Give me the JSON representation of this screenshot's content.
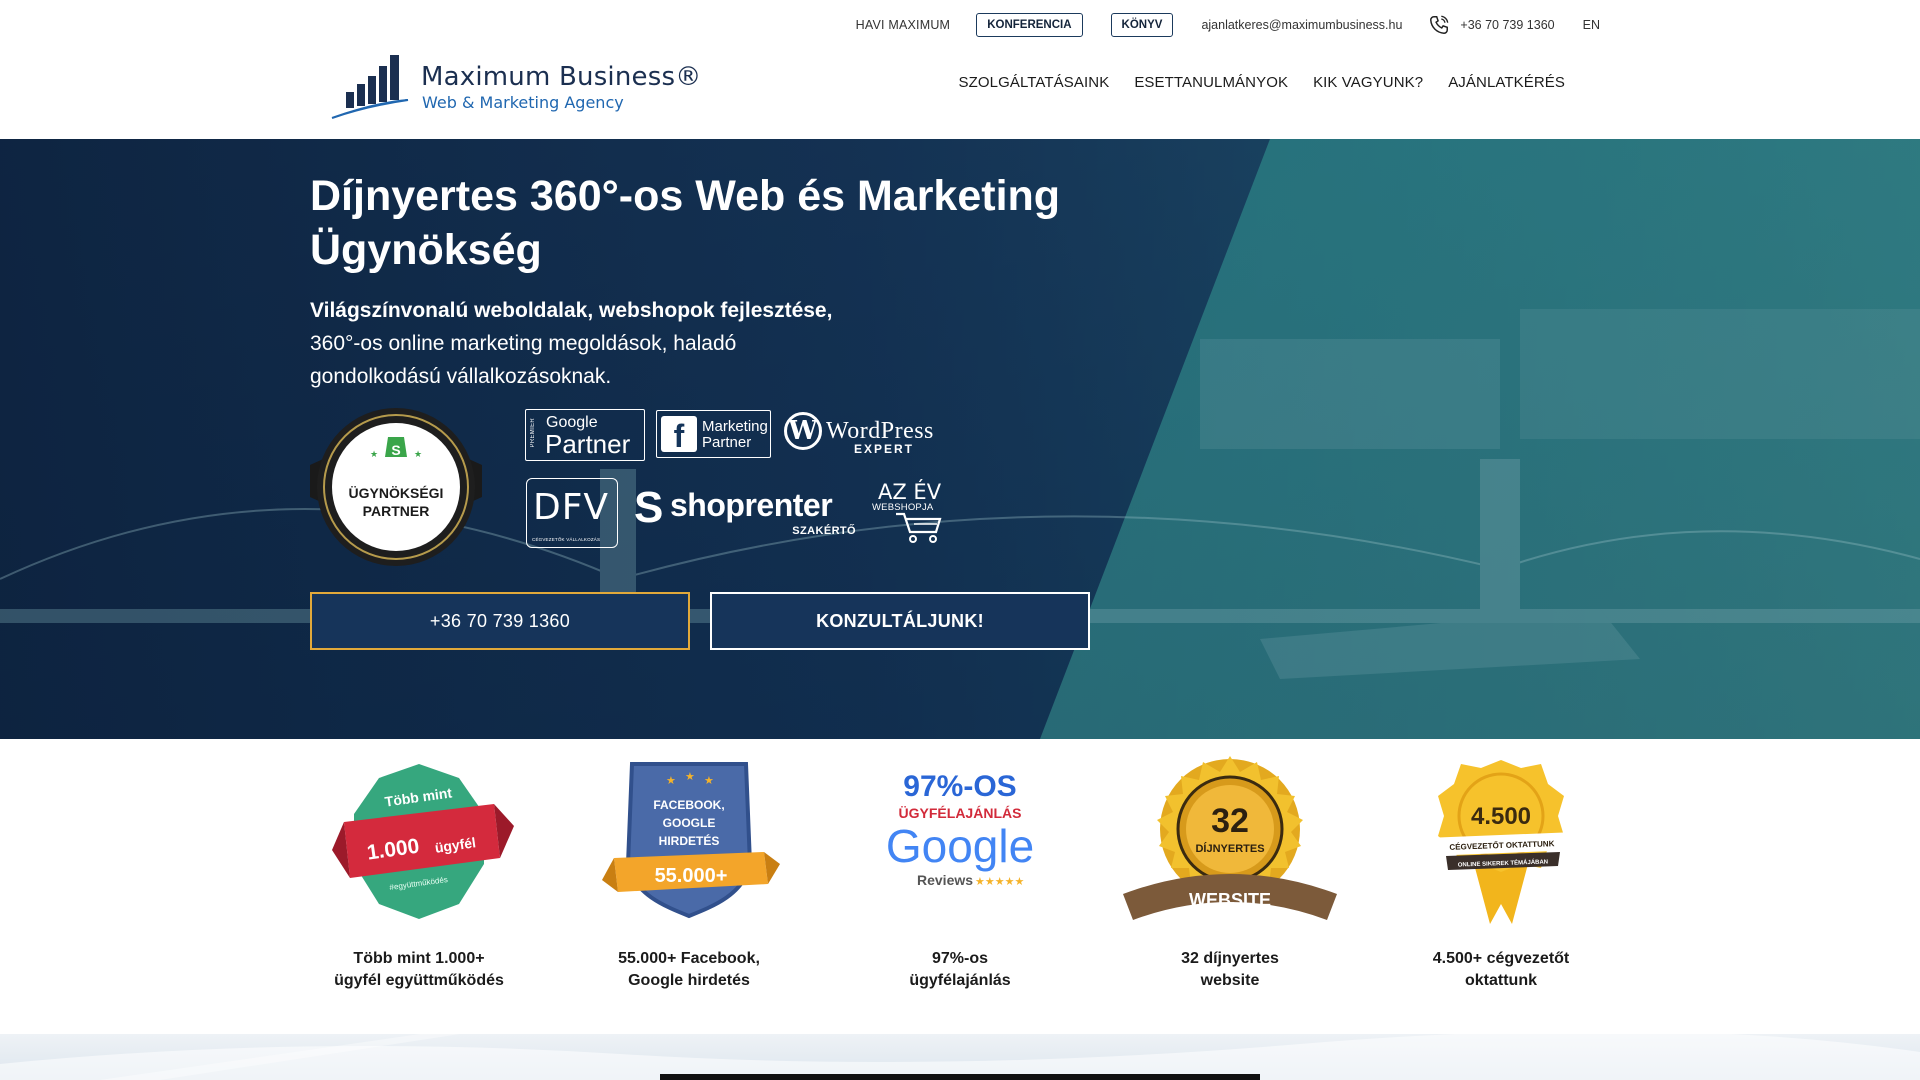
{
  "topbar": {
    "havi_maximum": "HAVI MAXIMUM",
    "konferencia": "KONFERENCIA",
    "konyv": "KÖNYV",
    "email": "ajanlatkeres@maximumbusiness.hu",
    "phone": "+36 70 739 1360",
    "lang": "EN"
  },
  "logo": {
    "name": "Maximum Business®",
    "tagline": "Web & Marketing Agency"
  },
  "nav": {
    "items": [
      "SZOLGÁLTATÁSAINK",
      "ESETTANULMÁNYOK",
      "KIK VAGYUNK?",
      "AJÁNLATKÉRÉS"
    ]
  },
  "hero": {
    "title_line1": "Díjnyertes 360°-os Web és Marketing",
    "title_line2": "Ügynökség",
    "sub_bold": "Világszínvonalú weboldalak, webshopok fejlesztése,",
    "sub_line2": "360°-os online marketing megoldások, haladó",
    "sub_line3": "gondolkodású vállalkozásoknak."
  },
  "partners": {
    "shoprenter_badge_line1": "ÜGYNÖKSÉGI",
    "shoprenter_badge_line2": "PARTNER",
    "google_premier": "PREMIER",
    "google_1": "Google",
    "google_2": "Partner",
    "fb_1": "Marketing",
    "fb_2": "Partner",
    "wp_1": "WordPress",
    "wp_2": "EXPERT",
    "dfv_1": "DFV",
    "dfv_2": "CÉGVEZETŐK VÁLLALKOZÁS",
    "shoprenter_1": "shoprenter",
    "shoprenter_2": "SZAKÉRTŐ",
    "azev_1": "AZ ÉV",
    "azev_2": "WEBSHOPJA"
  },
  "cta": {
    "phone": "+36 70 739 1360",
    "consult": "KONZULTÁLJUNK!"
  },
  "stats": [
    {
      "badge_top": "Több mint",
      "badge_mid": "1.000",
      "badge_mid2": "ügyfél",
      "badge_bot": "#együttműködés",
      "line1": "Több mint 1.000+",
      "line2": "ügyfél együttműködés"
    },
    {
      "badge_top": "FACEBOOK,",
      "badge_mid": "GOOGLE",
      "badge_mid2": "HIRDETÉS",
      "badge_bot": "55.000+",
      "line1": "55.000+ Facebook,",
      "line2": "Google hirdetés"
    },
    {
      "badge_top": "97%-OS",
      "badge_mid": "ÜGYFÉLAJÁNLÁS",
      "badge_mid2": "Google",
      "badge_bot": "Reviews",
      "line1": "97%-os",
      "line2": "ügyfélajánlás"
    },
    {
      "badge_top": "32",
      "badge_mid": "DÍJNYERTES",
      "badge_mid2": "",
      "badge_bot": "WEBSITE",
      "line1": "32 díjnyertes",
      "line2": "website"
    },
    {
      "badge_top": "4.500",
      "badge_mid": "CÉGVEZETŐT OKTATTUNK",
      "badge_mid2": "ONLINE SIKEREK TÉMÁJÁBAN",
      "badge_bot": "",
      "line1": "4.500+ cégvezetőt",
      "line2": "oktattunk"
    }
  ],
  "colors": {
    "navy": "#16345a",
    "teal": "#2f7f80",
    "gold": "#e2a93a",
    "google_blue": "#4285f4",
    "red": "#d22a3a"
  }
}
